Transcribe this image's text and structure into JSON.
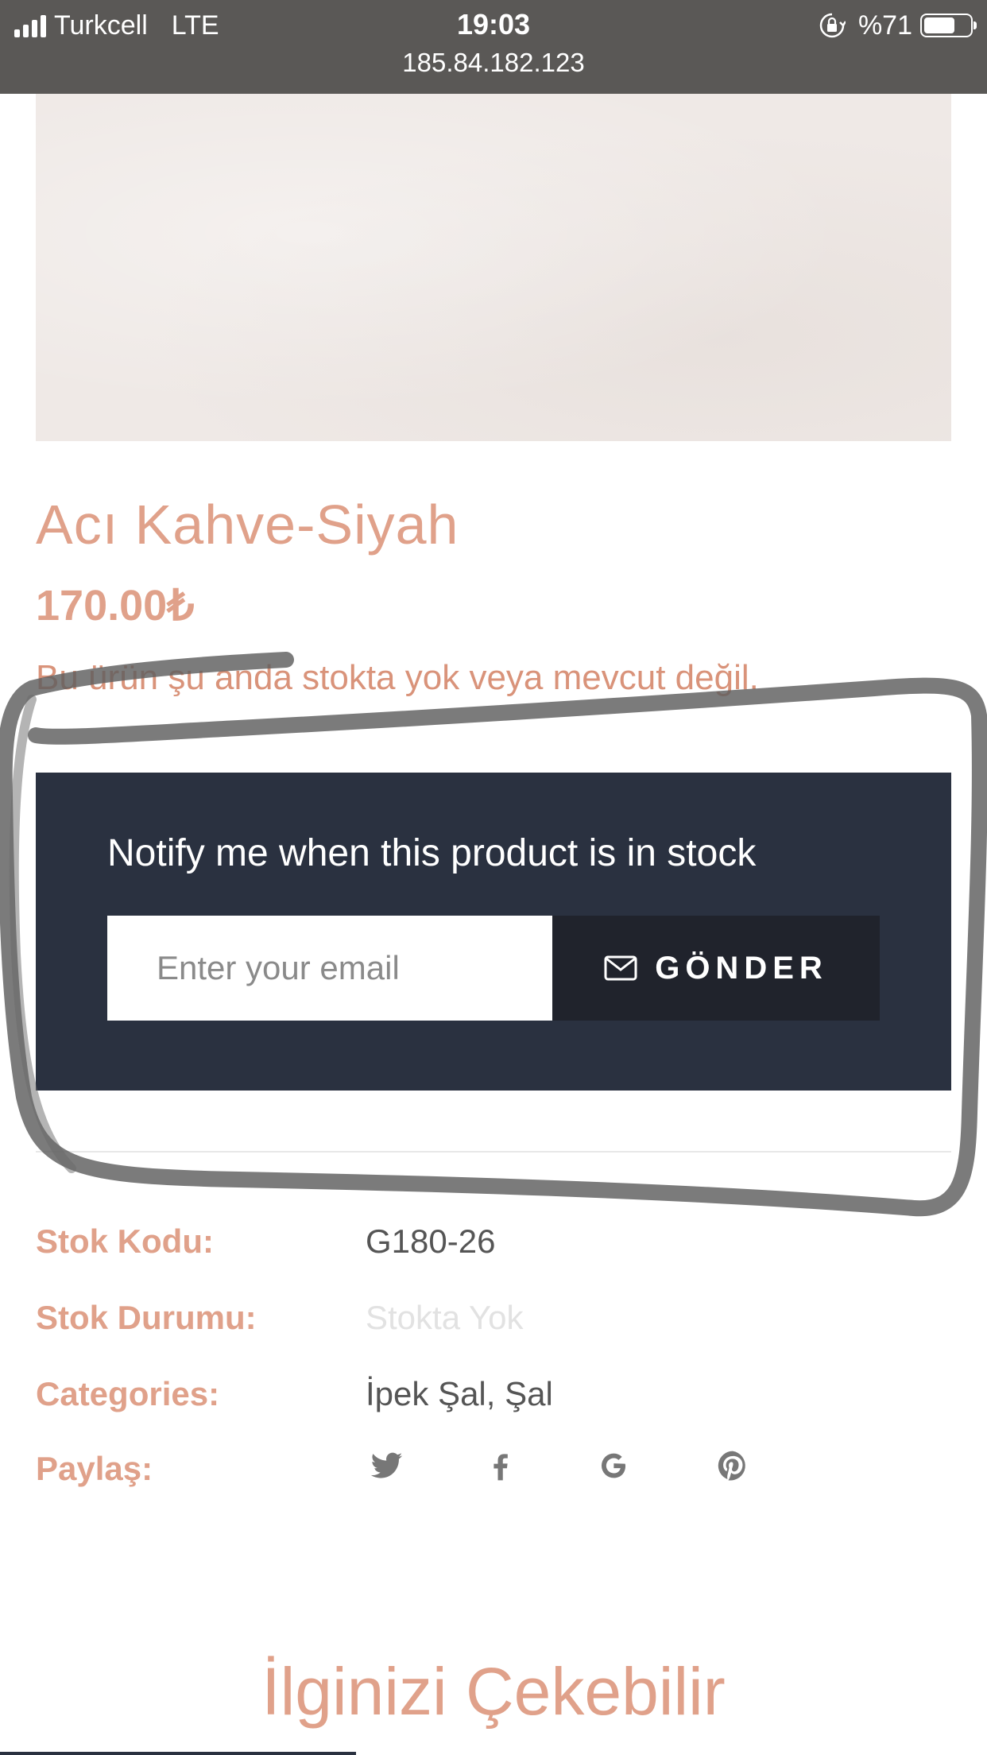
{
  "status_bar": {
    "carrier": "Turkcell",
    "network": "LTE",
    "time": "19:03",
    "url": "185.84.182.123",
    "battery_text": "%71",
    "battery_level": 0.71
  },
  "product": {
    "title": "Acı Kahve-Siyah",
    "price": "170.00₺",
    "stock_message": "Bu ürün şu anda stokta yok veya mevcut değil."
  },
  "notify": {
    "heading": "Notify me when this product is in stock",
    "email_placeholder": "Enter your email",
    "send_label": "GÖNDER"
  },
  "meta": {
    "sku_label": "Stok Kodu:",
    "sku_value": "G180-26",
    "stock_label": "Stok Durumu:",
    "stock_value": "Stokta Yok",
    "categories_label": "Categories:",
    "categories_value": "İpek Şal, Şal",
    "share_label": "Paylaş:",
    "share_icons": [
      "twitter-icon",
      "facebook-icon",
      "google-icon",
      "pinterest-icon"
    ]
  },
  "related": {
    "title": "İlginizi Çekebilir"
  },
  "colors": {
    "accent": "#e0a18a",
    "notify_bg": "#2a3140",
    "button_bg": "#20232c",
    "status_bar_bg": "#5a5856"
  }
}
